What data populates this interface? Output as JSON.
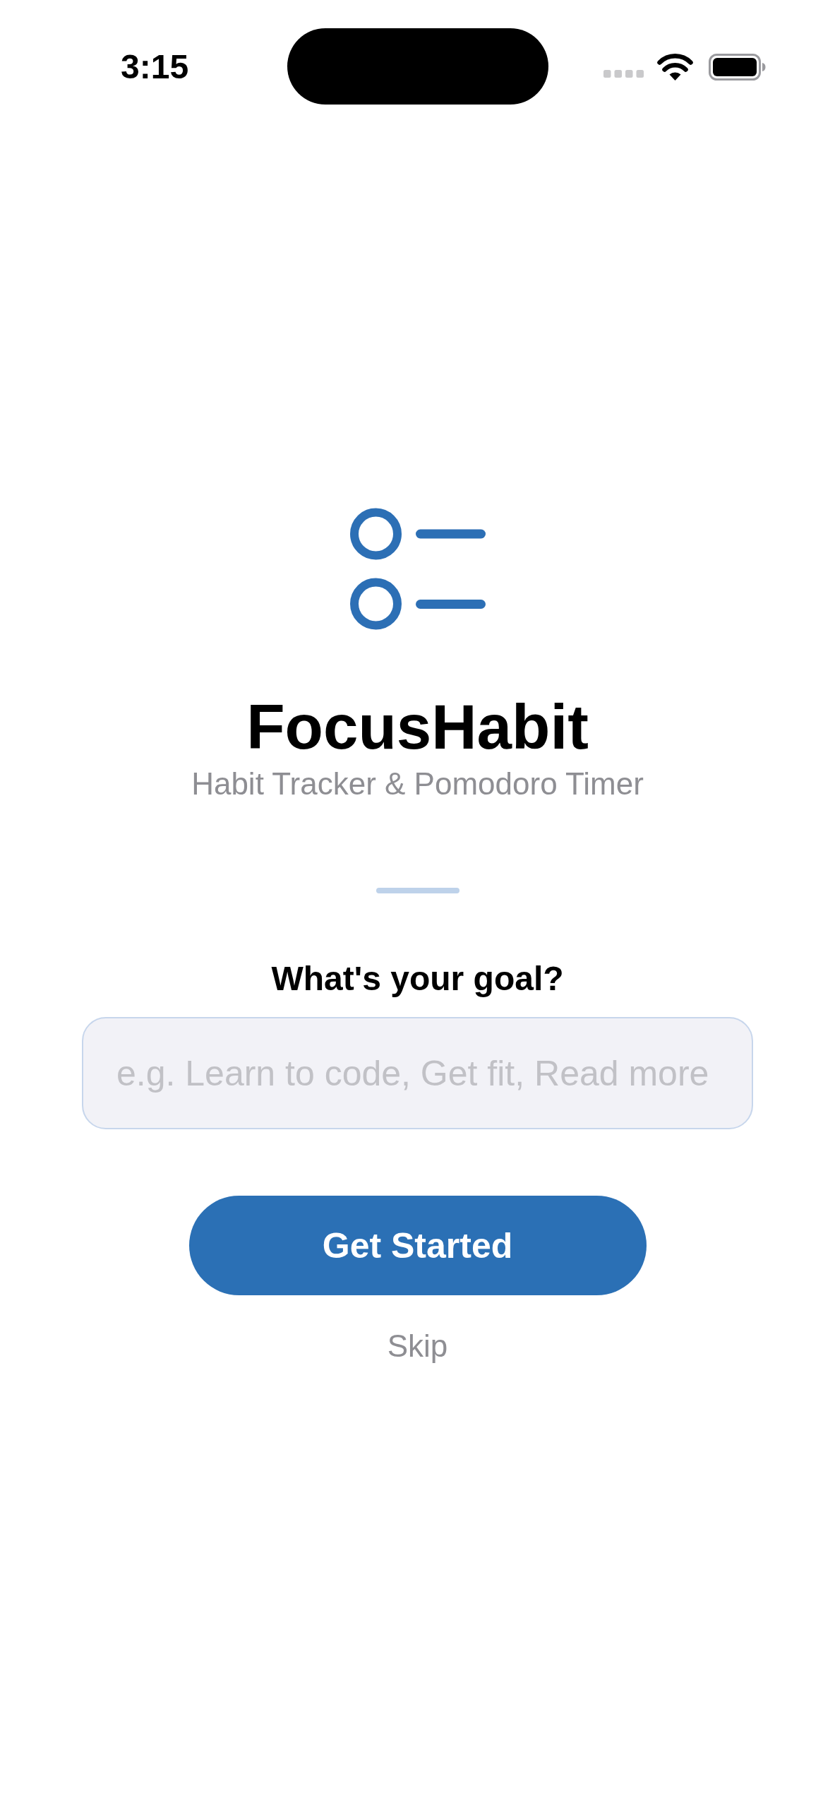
{
  "status_bar": {
    "time": "3:15"
  },
  "app": {
    "name": "FocusHabit",
    "tagline": "Habit Tracker & Pomodoro Timer"
  },
  "goal": {
    "label": "What's your goal?",
    "placeholder": "e.g. Learn to code, Get fit, Read more"
  },
  "buttons": [
    {
      "kind": "primary",
      "label": "Get Started"
    },
    {
      "kind": "link",
      "label": "Skip"
    }
  ]
}
